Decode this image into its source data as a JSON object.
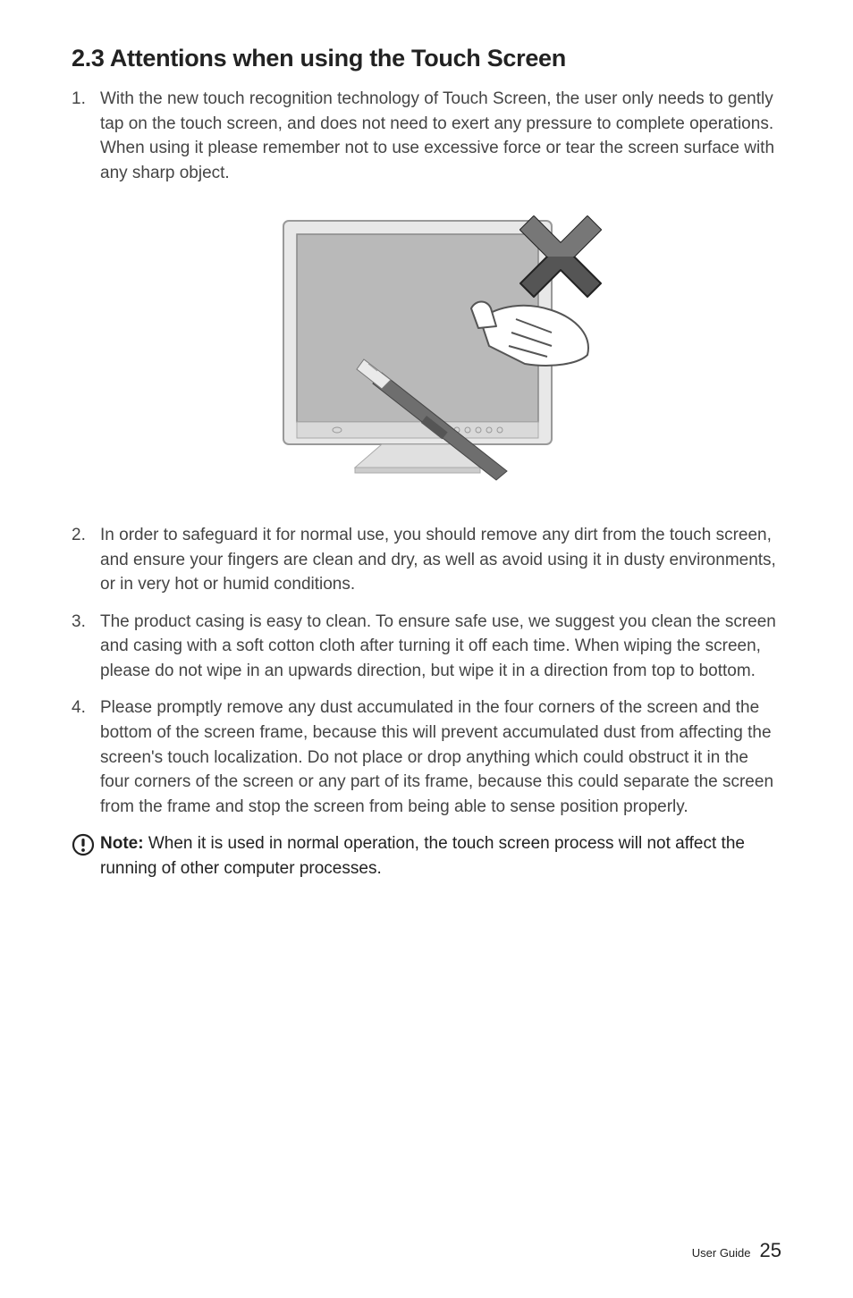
{
  "heading": "2.3 Attentions when using the Touch Screen",
  "items": [
    {
      "num": "1.",
      "text": "With the new touch recognition technology of Touch Screen, the user only needs to gently tap on the touch screen, and does not need to exert any pressure to complete operations. When using it please remember not to use excessive force or tear the screen surface with any sharp object."
    },
    {
      "num": "2.",
      "text": "In order to safeguard it for normal use, you should remove any dirt from the touch screen, and ensure your fingers are clean and dry, as well as avoid using it in dusty environments, or in very hot or humid conditions."
    },
    {
      "num": "3.",
      "text": "The product casing is easy to clean. To ensure safe use, we suggest you clean the screen and casing with a soft cotton cloth after turning it off each time. When wiping the screen, please do not wipe in an upwards direction, but wipe it in a direction from top to bottom."
    },
    {
      "num": "4.",
      "text": "Please promptly remove any dust accumulated in the four corners of the screen and the bottom of the screen frame, because this will prevent accumulated dust from affecting the screen's touch localization. Do not place or drop anything which could obstruct it in the four corners of the screen or any part of its frame, because this could separate the screen from the frame and stop the screen from being able to sense position properly."
    }
  ],
  "note": {
    "label": "Note:",
    "text": " When it is used in normal operation, the touch screen process will not affect the running of other computer processes."
  },
  "footer": {
    "label": "User Guide",
    "page": "25"
  },
  "illustration": {
    "alt": "monitor-with-sharp-object-do-not-use"
  }
}
